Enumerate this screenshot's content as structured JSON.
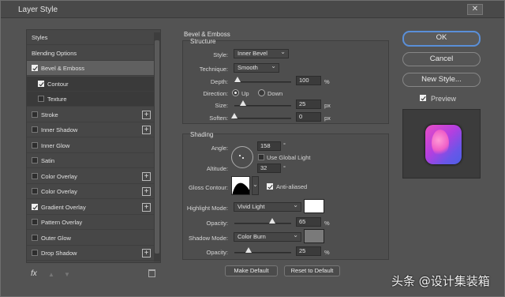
{
  "window": {
    "title": "Layer Style",
    "close_glyph": "✕"
  },
  "left_list": {
    "items": [
      {
        "label": "Styles",
        "checkbox": null,
        "plus": false
      },
      {
        "label": "Blending Options",
        "checkbox": null,
        "plus": false
      },
      {
        "label": "Bevel & Emboss",
        "checkbox": true,
        "plus": false,
        "selected": true
      },
      {
        "label": "Contour",
        "checkbox": true,
        "plus": false,
        "sub": true
      },
      {
        "label": "Texture",
        "checkbox": false,
        "plus": false,
        "sub": true
      },
      {
        "label": "Stroke",
        "checkbox": false,
        "plus": true
      },
      {
        "label": "Inner Shadow",
        "checkbox": false,
        "plus": true
      },
      {
        "label": "Inner Glow",
        "checkbox": false,
        "plus": false
      },
      {
        "label": "Satin",
        "checkbox": false,
        "plus": false
      },
      {
        "label": "Color Overlay",
        "checkbox": false,
        "plus": true
      },
      {
        "label": "Color Overlay",
        "checkbox": false,
        "plus": true
      },
      {
        "label": "Gradient Overlay",
        "checkbox": true,
        "plus": true
      },
      {
        "label": "Pattern Overlay",
        "checkbox": false,
        "plus": false
      },
      {
        "label": "Outer Glow",
        "checkbox": false,
        "plus": false
      },
      {
        "label": "Drop Shadow",
        "checkbox": false,
        "plus": true
      }
    ],
    "footer": {
      "fx": "fx",
      "up": "▲",
      "down": "▼",
      "trash": "🗑"
    }
  },
  "bevel": {
    "section": "Bevel & Emboss",
    "structure": "Structure",
    "style_label": "Style:",
    "style_value": "Inner Bevel",
    "technique_label": "Technique:",
    "technique_value": "Smooth",
    "depth_label": "Depth:",
    "depth_value": "100",
    "depth_unit": "%",
    "direction_label": "Direction:",
    "dir_up": "Up",
    "dir_down": "Down",
    "size_label": "Size:",
    "size_value": "25",
    "size_unit": "px",
    "soften_label": "Soften:",
    "soften_value": "0",
    "soften_unit": "px"
  },
  "shading": {
    "section": "Shading",
    "angle_label": "Angle:",
    "angle_value": "158",
    "angle_unit": "°",
    "global_light": "Use Global Light",
    "altitude_label": "Altitude:",
    "altitude_value": "32",
    "altitude_unit": "°",
    "gloss_label": "Gloss Contour:",
    "anti_aliased": "Anti-aliased",
    "highlight_label": "Highlight Mode:",
    "highlight_value": "Vivid Light",
    "hl_opacity_label": "Opacity:",
    "hl_opacity_value": "65",
    "hl_opacity_unit": "%",
    "shadow_label": "Shadow Mode:",
    "shadow_value": "Color Burn",
    "sh_opacity_label": "Opacity:",
    "sh_opacity_value": "25",
    "sh_opacity_unit": "%",
    "make_default": "Make Default",
    "reset_default": "Reset to Default",
    "highlight_color": "#ffffff",
    "shadow_color": "#7a7a7a"
  },
  "buttons": {
    "ok": "OK",
    "cancel": "Cancel",
    "new_style": "New Style...",
    "preview": "Preview"
  },
  "watermark": "头条 @设计集装箱"
}
